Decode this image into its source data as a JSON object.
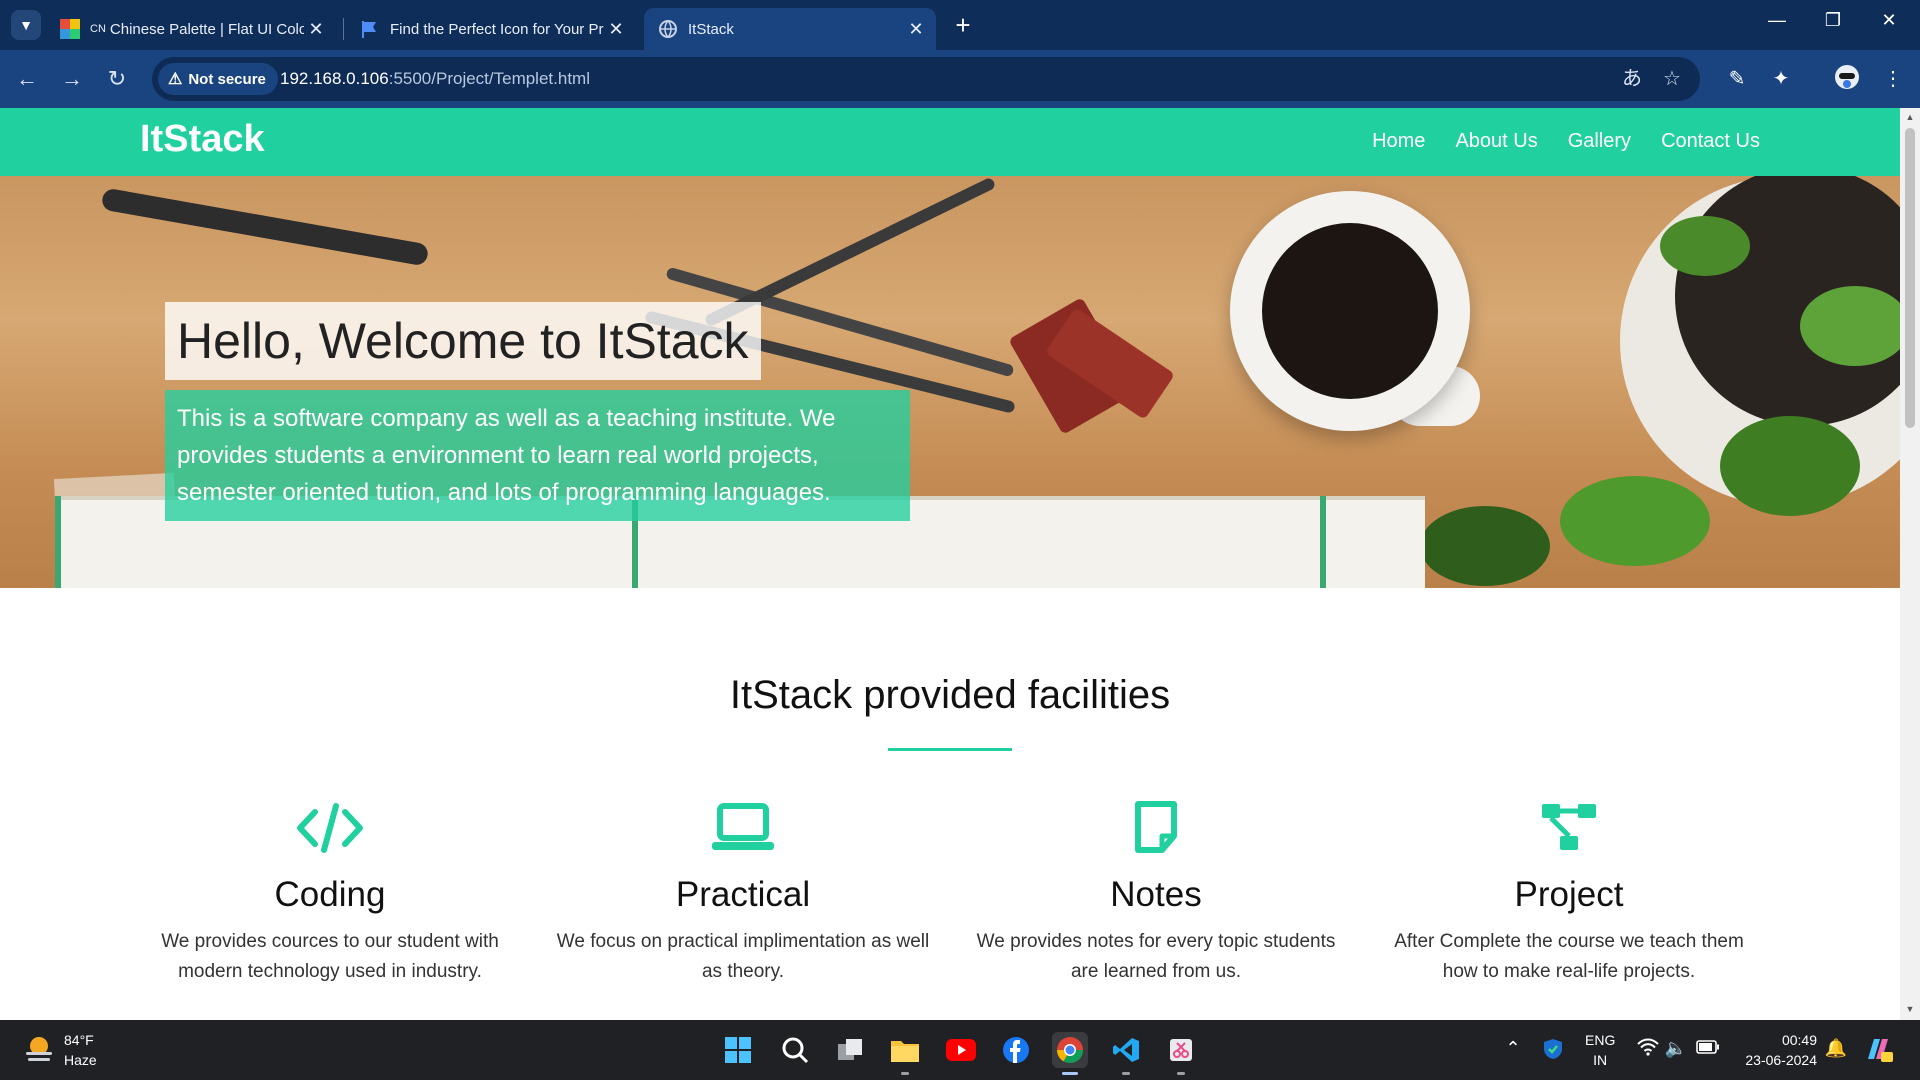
{
  "browser": {
    "tabs": [
      {
        "title": "Chinese Palette | Flat UI Colors",
        "favicon_text": "CN",
        "active": false
      },
      {
        "title": "Find the Perfect Icon for Your Project",
        "active": false
      },
      {
        "title": "ItStack",
        "active": true
      }
    ],
    "new_tab": "+",
    "security_label": "Not secure",
    "url_host": "192.168.0.106",
    "url_rest": ":5500/Project/Templet.html"
  },
  "site": {
    "brand": "ItStack",
    "nav": [
      "Home",
      "About Us",
      "Gallery",
      "Contact Us"
    ],
    "hero_title": "Hello, Welcome to ItStack",
    "hero_text": "This is a software company as well as a teaching institute. We provides students a environment to learn real world projects, semester oriented tution, and lots of programming languages.",
    "section_title": "ItStack provided facilities",
    "facilities": [
      {
        "title": "Coding",
        "text": "We provides cources to our student with modern technology used in industry.",
        "icon": "code-icon"
      },
      {
        "title": "Practical",
        "text": "We focus on practical implimentation as well as theory.",
        "icon": "laptop-icon"
      },
      {
        "title": "Notes",
        "text": "We provides notes for every topic students are learned from us.",
        "icon": "note-icon"
      },
      {
        "title": "Project",
        "text": "After Complete the course we teach them how to make real-life projects.",
        "icon": "diagram-project-icon"
      }
    ],
    "accent_color": "#21d09f"
  },
  "taskbar": {
    "weather_temp": "84°F",
    "weather_desc": "Haze",
    "lang_top": "ENG",
    "lang_bottom": "IN",
    "time": "00:49",
    "date": "23-06-2024"
  }
}
